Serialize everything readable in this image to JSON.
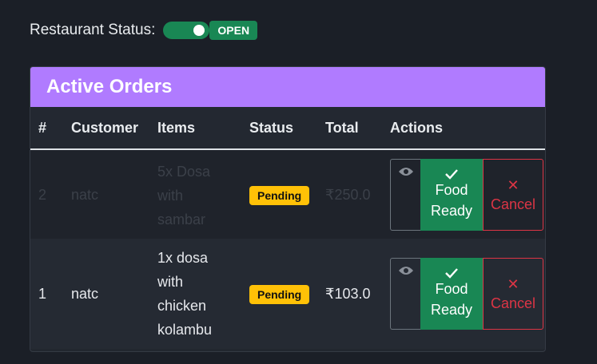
{
  "status_bar": {
    "label": "Restaurant Status:",
    "badge": "OPEN",
    "toggle_on": true
  },
  "orders_card": {
    "title": "Active Orders",
    "columns": [
      "#",
      "Customer",
      "Items",
      "Status",
      "Total",
      "Actions"
    ],
    "rows": [
      {
        "id": "2",
        "customer": "natc",
        "items": [
          "5x Dosa",
          "with",
          "sambar"
        ],
        "status": "Pending",
        "total": "₹250.0"
      },
      {
        "id": "1",
        "customer": "natc",
        "items": [
          "1x dosa",
          "with",
          "chicken",
          "kolambu"
        ],
        "status": "Pending",
        "total": "₹103.0"
      }
    ],
    "actions": {
      "ready_line1": "Food",
      "ready_line2": "Ready",
      "cancel": "Cancel"
    }
  },
  "colors": {
    "accent": "#b07bff",
    "success": "#198754",
    "danger": "#dc3545",
    "warning": "#ffc107"
  }
}
